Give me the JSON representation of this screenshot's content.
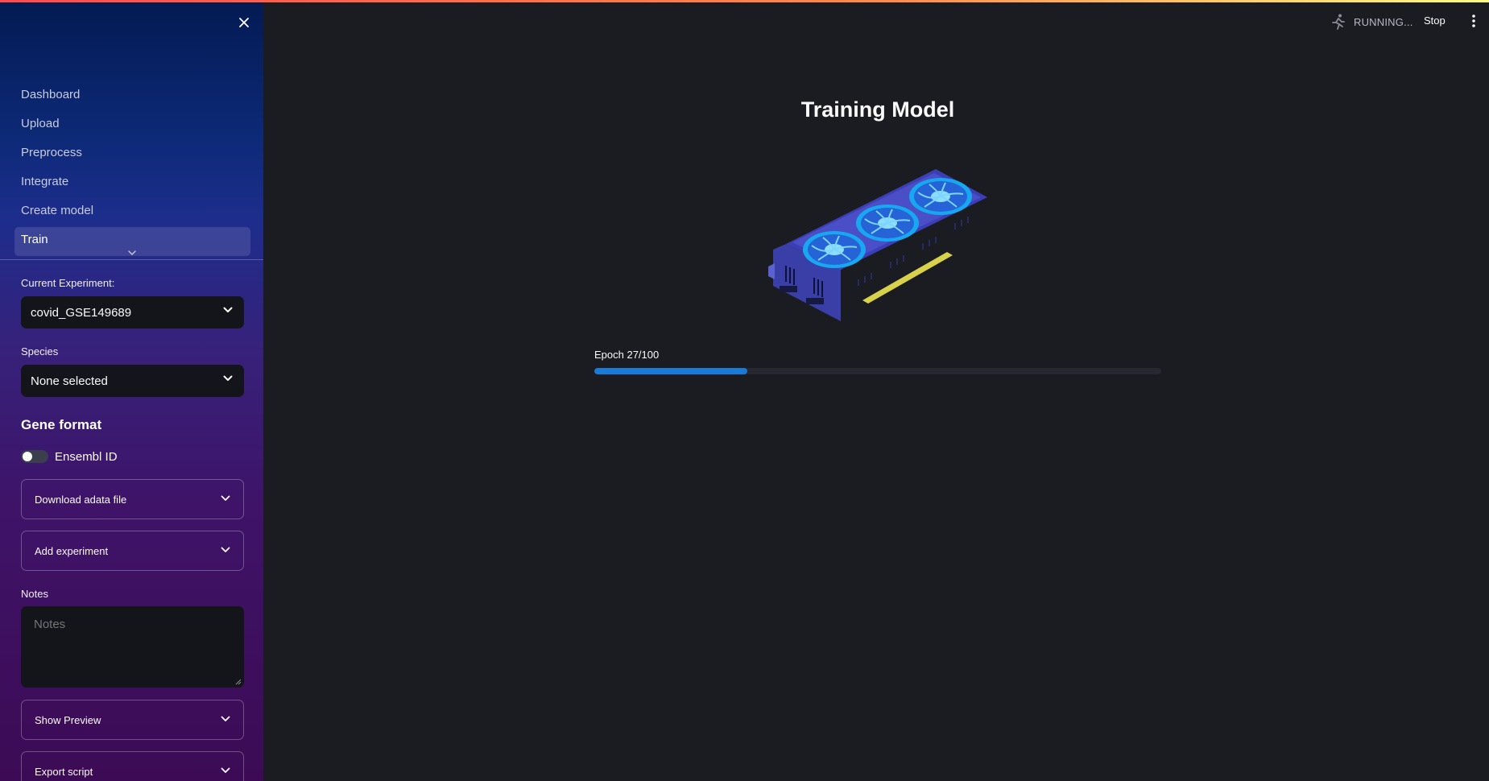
{
  "sidebar": {
    "nav_items": [
      {
        "label": "Dashboard",
        "active": false
      },
      {
        "label": "Upload",
        "active": false
      },
      {
        "label": "Preprocess",
        "active": false
      },
      {
        "label": "Integrate",
        "active": false
      },
      {
        "label": "Create model",
        "active": false
      },
      {
        "label": "Train",
        "active": true
      }
    ],
    "current_experiment": {
      "label": "Current Experiment:",
      "value": "covid_GSE149689"
    },
    "species": {
      "label": "Species",
      "value": "None selected"
    },
    "gene_format": {
      "title": "Gene format",
      "toggle_label": "Ensembl ID",
      "toggle_on": false
    },
    "expanders": {
      "download": "Download adata file",
      "add_experiment": "Add experiment",
      "show_preview": "Show Preview",
      "export_script": "Export script"
    },
    "notes": {
      "label": "Notes",
      "placeholder": "Notes"
    }
  },
  "header": {
    "status": "RUNNING...",
    "stop_label": "Stop"
  },
  "main": {
    "title": "Training Model",
    "progress": {
      "label": "Epoch 27/100",
      "value": 0.27
    }
  },
  "icons": [
    "close-icon",
    "chevron-down-icon",
    "running-icon",
    "more-vertical-icon",
    "gpu-card-image"
  ],
  "colors": {
    "accent": "#1a7bd6",
    "background": "#1b1c21",
    "sidebar_top": "#031a52",
    "sidebar_bottom": "#3d0b55"
  }
}
